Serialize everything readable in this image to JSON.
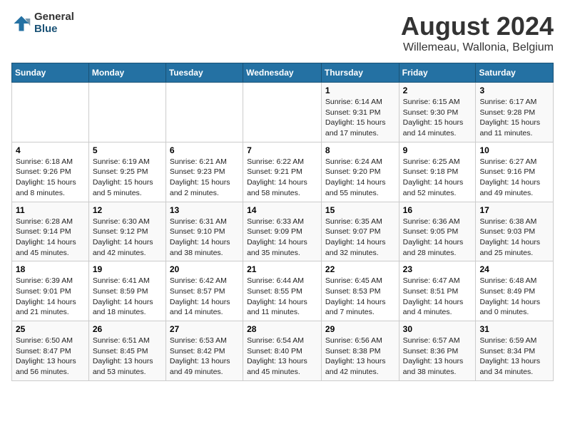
{
  "logo": {
    "general": "General",
    "blue": "Blue"
  },
  "title": "August 2024",
  "subtitle": "Willemeau, Wallonia, Belgium",
  "calendar": {
    "headers": [
      "Sunday",
      "Monday",
      "Tuesday",
      "Wednesday",
      "Thursday",
      "Friday",
      "Saturday"
    ],
    "rows": [
      [
        {
          "day": "",
          "info": ""
        },
        {
          "day": "",
          "info": ""
        },
        {
          "day": "",
          "info": ""
        },
        {
          "day": "",
          "info": ""
        },
        {
          "day": "1",
          "info": "Sunrise: 6:14 AM\nSunset: 9:31 PM\nDaylight: 15 hours\nand 17 minutes."
        },
        {
          "day": "2",
          "info": "Sunrise: 6:15 AM\nSunset: 9:30 PM\nDaylight: 15 hours\nand 14 minutes."
        },
        {
          "day": "3",
          "info": "Sunrise: 6:17 AM\nSunset: 9:28 PM\nDaylight: 15 hours\nand 11 minutes."
        }
      ],
      [
        {
          "day": "4",
          "info": "Sunrise: 6:18 AM\nSunset: 9:26 PM\nDaylight: 15 hours\nand 8 minutes."
        },
        {
          "day": "5",
          "info": "Sunrise: 6:19 AM\nSunset: 9:25 PM\nDaylight: 15 hours\nand 5 minutes."
        },
        {
          "day": "6",
          "info": "Sunrise: 6:21 AM\nSunset: 9:23 PM\nDaylight: 15 hours\nand 2 minutes."
        },
        {
          "day": "7",
          "info": "Sunrise: 6:22 AM\nSunset: 9:21 PM\nDaylight: 14 hours\nand 58 minutes."
        },
        {
          "day": "8",
          "info": "Sunrise: 6:24 AM\nSunset: 9:20 PM\nDaylight: 14 hours\nand 55 minutes."
        },
        {
          "day": "9",
          "info": "Sunrise: 6:25 AM\nSunset: 9:18 PM\nDaylight: 14 hours\nand 52 minutes."
        },
        {
          "day": "10",
          "info": "Sunrise: 6:27 AM\nSunset: 9:16 PM\nDaylight: 14 hours\nand 49 minutes."
        }
      ],
      [
        {
          "day": "11",
          "info": "Sunrise: 6:28 AM\nSunset: 9:14 PM\nDaylight: 14 hours\nand 45 minutes."
        },
        {
          "day": "12",
          "info": "Sunrise: 6:30 AM\nSunset: 9:12 PM\nDaylight: 14 hours\nand 42 minutes."
        },
        {
          "day": "13",
          "info": "Sunrise: 6:31 AM\nSunset: 9:10 PM\nDaylight: 14 hours\nand 38 minutes."
        },
        {
          "day": "14",
          "info": "Sunrise: 6:33 AM\nSunset: 9:09 PM\nDaylight: 14 hours\nand 35 minutes."
        },
        {
          "day": "15",
          "info": "Sunrise: 6:35 AM\nSunset: 9:07 PM\nDaylight: 14 hours\nand 32 minutes."
        },
        {
          "day": "16",
          "info": "Sunrise: 6:36 AM\nSunset: 9:05 PM\nDaylight: 14 hours\nand 28 minutes."
        },
        {
          "day": "17",
          "info": "Sunrise: 6:38 AM\nSunset: 9:03 PM\nDaylight: 14 hours\nand 25 minutes."
        }
      ],
      [
        {
          "day": "18",
          "info": "Sunrise: 6:39 AM\nSunset: 9:01 PM\nDaylight: 14 hours\nand 21 minutes."
        },
        {
          "day": "19",
          "info": "Sunrise: 6:41 AM\nSunset: 8:59 PM\nDaylight: 14 hours\nand 18 minutes."
        },
        {
          "day": "20",
          "info": "Sunrise: 6:42 AM\nSunset: 8:57 PM\nDaylight: 14 hours\nand 14 minutes."
        },
        {
          "day": "21",
          "info": "Sunrise: 6:44 AM\nSunset: 8:55 PM\nDaylight: 14 hours\nand 11 minutes."
        },
        {
          "day": "22",
          "info": "Sunrise: 6:45 AM\nSunset: 8:53 PM\nDaylight: 14 hours\nand 7 minutes."
        },
        {
          "day": "23",
          "info": "Sunrise: 6:47 AM\nSunset: 8:51 PM\nDaylight: 14 hours\nand 4 minutes."
        },
        {
          "day": "24",
          "info": "Sunrise: 6:48 AM\nSunset: 8:49 PM\nDaylight: 14 hours\nand 0 minutes."
        }
      ],
      [
        {
          "day": "25",
          "info": "Sunrise: 6:50 AM\nSunset: 8:47 PM\nDaylight: 13 hours\nand 56 minutes."
        },
        {
          "day": "26",
          "info": "Sunrise: 6:51 AM\nSunset: 8:45 PM\nDaylight: 13 hours\nand 53 minutes."
        },
        {
          "day": "27",
          "info": "Sunrise: 6:53 AM\nSunset: 8:42 PM\nDaylight: 13 hours\nand 49 minutes."
        },
        {
          "day": "28",
          "info": "Sunrise: 6:54 AM\nSunset: 8:40 PM\nDaylight: 13 hours\nand 45 minutes."
        },
        {
          "day": "29",
          "info": "Sunrise: 6:56 AM\nSunset: 8:38 PM\nDaylight: 13 hours\nand 42 minutes."
        },
        {
          "day": "30",
          "info": "Sunrise: 6:57 AM\nSunset: 8:36 PM\nDaylight: 13 hours\nand 38 minutes."
        },
        {
          "day": "31",
          "info": "Sunrise: 6:59 AM\nSunset: 8:34 PM\nDaylight: 13 hours\nand 34 minutes."
        }
      ]
    ]
  }
}
